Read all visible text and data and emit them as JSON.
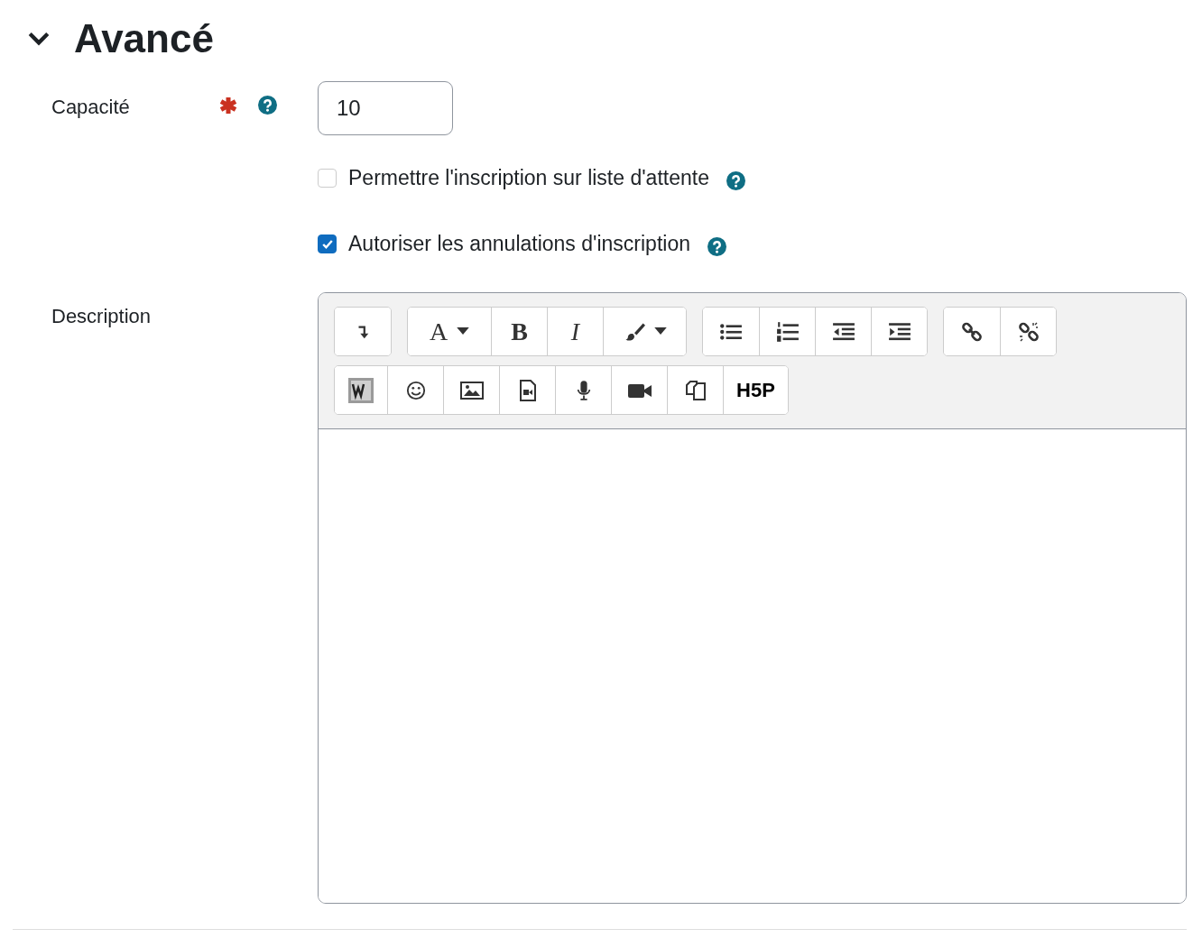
{
  "section": {
    "title": "Avancé",
    "expanded": true
  },
  "capacity": {
    "label": "Capacité",
    "required": true,
    "help": true,
    "value": "10"
  },
  "checkboxes": [
    {
      "label": "Permettre l'inscription sur liste d'attente",
      "checked": false,
      "help": true
    },
    {
      "label": "Autoriser les annulations d'inscription",
      "checked": true,
      "help": true
    }
  ],
  "description": {
    "label": "Description",
    "toolbar": [
      [
        [
          {
            "kind": "collapse"
          }
        ],
        [
          {
            "kind": "font",
            "label": "A",
            "caret": true
          },
          {
            "kind": "bold",
            "label": "B"
          },
          {
            "kind": "italic",
            "label": "I"
          },
          {
            "kind": "brush",
            "caret": true
          }
        ],
        [
          {
            "kind": "bullets"
          },
          {
            "kind": "numbers"
          },
          {
            "kind": "outdent"
          },
          {
            "kind": "indent"
          }
        ],
        [
          {
            "kind": "link"
          },
          {
            "kind": "unlink"
          }
        ]
      ],
      [
        [
          {
            "kind": "wiris"
          },
          {
            "kind": "emoji"
          },
          {
            "kind": "image"
          },
          {
            "kind": "media"
          },
          {
            "kind": "audio"
          },
          {
            "kind": "video"
          },
          {
            "kind": "files"
          },
          {
            "kind": "h5p",
            "label": "H5P"
          }
        ]
      ]
    ]
  }
}
